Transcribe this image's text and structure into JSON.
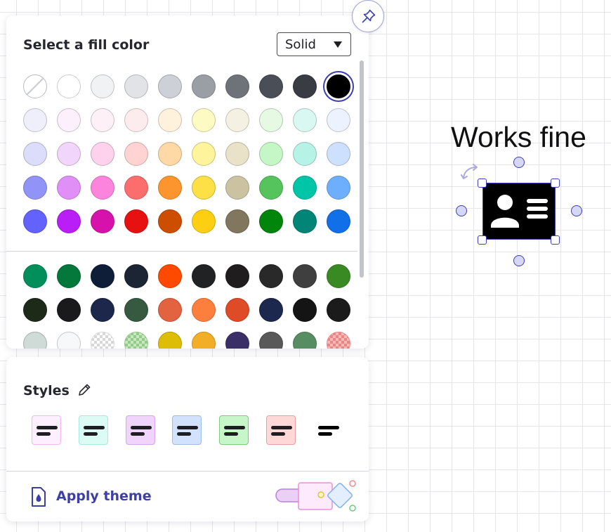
{
  "fill_panel": {
    "title": "Select a fill color",
    "fill_type": "Solid",
    "selected_color": "#000000",
    "palette_rows": [
      [
        "none",
        "#ffffff",
        "#f1f2f4",
        "#e1e3e7",
        "#cdd0d6",
        "#9a9ea5",
        "#6e7279",
        "#4a4e56",
        "#393c43",
        "#000000"
      ],
      [
        "#efeffc",
        "#fbf0fc",
        "#fdf0f7",
        "#fdeced",
        "#fef2dc",
        "#fefac4",
        "#f5f1e2",
        "#e6f9e3",
        "#d8f8f1",
        "#ecf2fe"
      ],
      [
        "#dcdcfb",
        "#f1d5fb",
        "#fed1ec",
        "#fed3d2",
        "#fed8a5",
        "#fdf49b",
        "#e9e1c8",
        "#c5f6c5",
        "#b6f2e6",
        "#cde0fd"
      ],
      [
        "#9293f7",
        "#e08ff7",
        "#fd84dd",
        "#fc6d6d",
        "#fc952d",
        "#fde045",
        "#cbc2a2",
        "#55c45c",
        "#00c5a6",
        "#6eaffd"
      ],
      [
        "#6462fc",
        "#b91ef7",
        "#d712ac",
        "#e81111",
        "#cd4e01",
        "#fccf13",
        "#81765e",
        "#02850b",
        "#028577",
        "#1170e8"
      ]
    ],
    "custom_rows": [
      [
        "#038f5c",
        "#04773a",
        "#0e1e38",
        "#1b2533",
        "#fe4a01",
        "#212224",
        "#1f1d1e",
        "#292929",
        "#3f3f3f",
        "#3a8a23"
      ],
      [
        "#1e2a18",
        "#1a1a1c",
        "#1c274b",
        "#355a3f",
        "#e3623f",
        "#fd7f3d",
        "#df4a27",
        "#1c284d",
        "#141414",
        "#1b1b1b"
      ],
      [
        "#cfdbd6",
        "#f7f8f9",
        "checker-white",
        "checker-green",
        "#ddbd05",
        "#f2ae27",
        "#3a2f66",
        "#595959",
        "#578d63",
        "checker-red"
      ]
    ]
  },
  "pin_button": {
    "icon": "pin-icon"
  },
  "styles_panel": {
    "title": "Styles",
    "edit_icon": "pencil-icon",
    "presets": [
      {
        "bg": "#fdeffd",
        "border": "#f1b9ef"
      },
      {
        "bg": "#dcfbf5",
        "border": "#a7ebdf"
      },
      {
        "bg": "#f0d4fb",
        "border": "#d5a7ef"
      },
      {
        "bg": "#d2e2fd",
        "border": "#9fbde9"
      },
      {
        "bg": "#c7f6c9",
        "border": "#7fcb84"
      },
      {
        "bg": "#fed8d7",
        "border": "#e9a1a0"
      },
      {
        "bg": "transparent",
        "border": "transparent"
      }
    ],
    "apply_theme_label": "Apply theme"
  },
  "canvas": {
    "text": "Works fine",
    "selected_shape": "contact-card-icon",
    "accent": "#3e3fb5"
  }
}
